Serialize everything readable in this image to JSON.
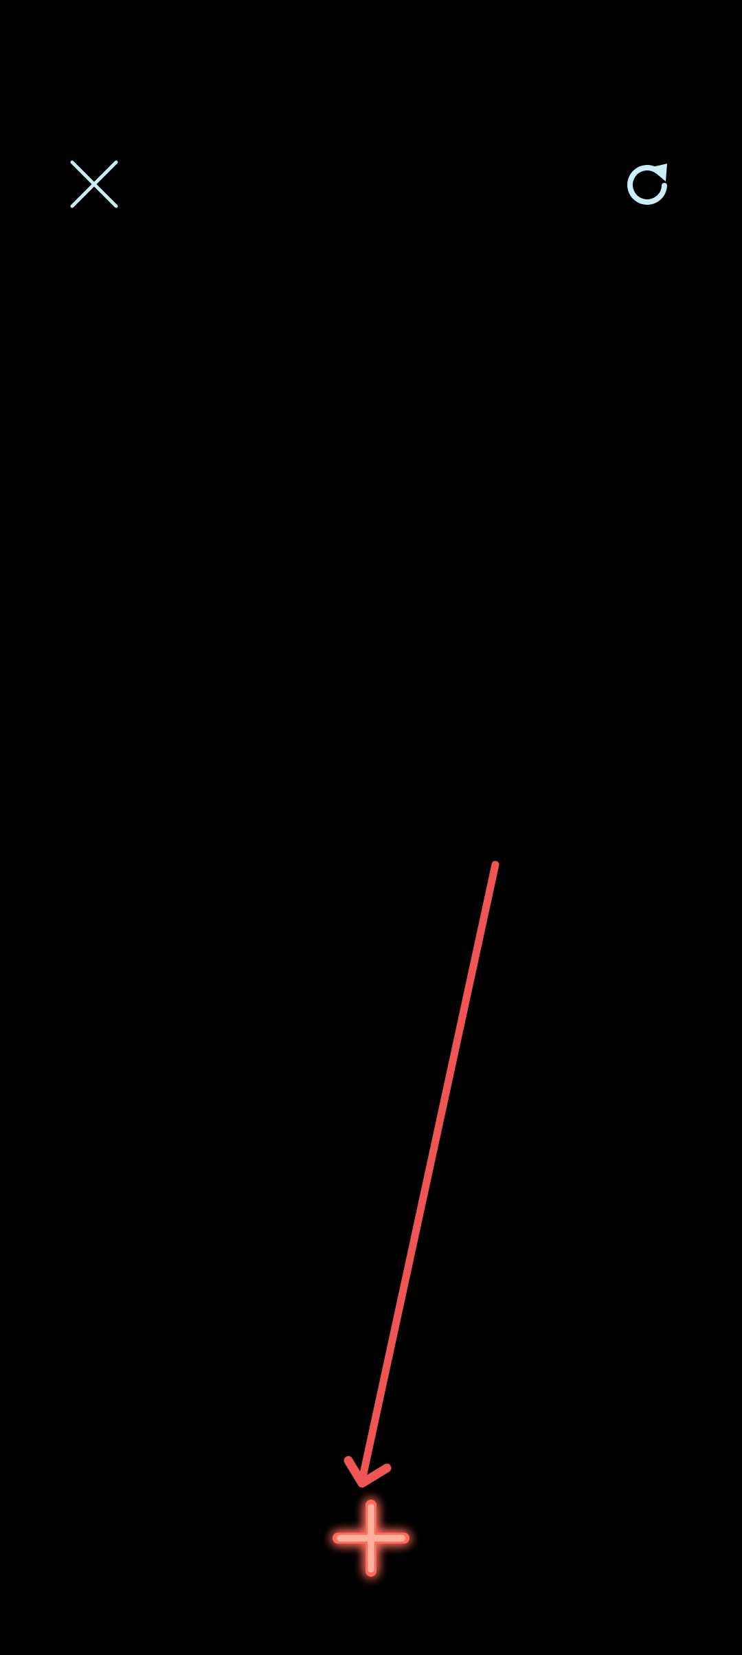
{
  "screen": {
    "background": "#000000",
    "accent_icon_color": "#c9eef6",
    "gesture_color": "#ee5553",
    "target_color": "#ff7c6b"
  },
  "toolbar": {
    "close": {
      "icon": "close-icon"
    },
    "reset": {
      "icon": "refresh-icon"
    }
  },
  "gesture": {
    "type": "drag-arrow",
    "icon": "arrow-icon"
  },
  "target": {
    "icon": "plus-icon",
    "glow": true
  }
}
